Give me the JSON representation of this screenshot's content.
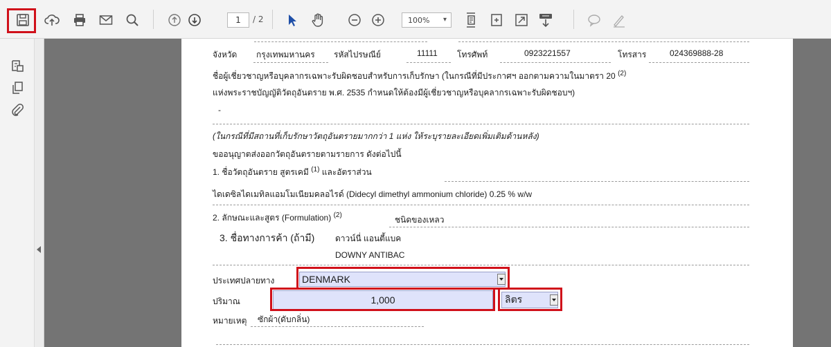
{
  "toolbar": {
    "page_current": "1",
    "page_total": "/ 2",
    "zoom": "100%",
    "icons": [
      "save-icon",
      "upload-icon",
      "print-icon",
      "email-icon",
      "search-icon",
      "page-up-icon",
      "page-down-icon",
      "select-cursor-icon",
      "hand-icon",
      "zoom-out-icon",
      "zoom-in-icon",
      "fit-page-icon",
      "fit-width-icon",
      "fullscreen-icon",
      "read-mode-icon",
      "comment-icon",
      "sign-icon"
    ],
    "highlight_color": "#d0101a"
  },
  "left_panel": {
    "icons": [
      "bookmark-icon",
      "pages-icon",
      "attachment-icon"
    ]
  },
  "document": {
    "row1": {
      "province_label": "จังหวัด",
      "province_value": "กรุงเทพมหานคร",
      "postal_label": "รหัสไปรษณีย์",
      "postal_value": "11111",
      "phone_label": "โทรศัพท์",
      "phone_value": "0923221557",
      "fax_label": "โทรสาร",
      "fax_value": "024369888-28"
    },
    "para1_line1": "ชื่อผู้เชี่ยวชาญหรือบุคลากรเฉพาะรับผิดชอบสำหรับการเก็บรักษา (ในกรณีที่มีประกาศฯ ออกตามความในมาตรา 20",
    "para1_sup": "(2)",
    "para1_line2": "แห่งพระราชบัญญัติวัตถุอันตราย พ.ศ. 2535 กำหนดให้ต้องมีผู้เชี่ยวชาญหรือบุคลากรเฉพาะรับผิดชอบฯ)",
    "dash_value": "-",
    "italic_note": "(ในกรณีที่มีสถานที่เก็บรักษาวัตถุอันตรายมากกว่า 1 แห่ง ให้ระบุรายละเอียดเพิ่มเติมด้านหลัง)",
    "request_line": "ขออนุญาตส่งออกวัตถุอันตรายตามรายการ ดังต่อไปนี้",
    "item1_label": "1. ชื่อวัตถุอันตราย สูตรเคมี",
    "item1_sup": "(1)",
    "item1_suffix": "และอัตราส่วน",
    "item1_value": "ไดเดซิลไดเมทิลแอมโมเนียมคลอไรด์ (Didecyl dimethyl ammonium chloride) 0.25 % w/w",
    "item2_label": "2. ลักษณะและสูตร (Formulation)",
    "item2_sup": "(2)",
    "item2_value": "ชนิดของเหลว",
    "item3_label": "3. ชื่อทางการค้า (ถ้ามี)",
    "item3_value_th": "ดาวน์นี่ แอนตี้แบค",
    "item3_value_en": "DOWNY ANTIBAC",
    "country_label": "ประเทศปลายทาง",
    "country_value": "DENMARK",
    "quantity_label": "ปริมาณ",
    "quantity_value": "1,000",
    "unit_value": "ลิตร",
    "remark_label": "หมายเหตุ",
    "remark_value": "ซักผ้า(ดับกลิ่น)"
  }
}
